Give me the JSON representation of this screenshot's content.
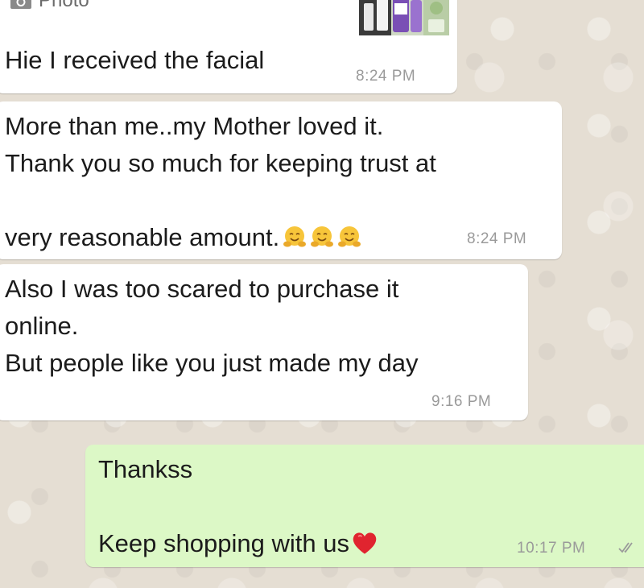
{
  "messages": [
    {
      "photo_label": "Photo",
      "text": "Hie I received the facial",
      "time": "8:24 PM",
      "icon": "camera-icon"
    },
    {
      "text_line1": "More than me..my Mother loved it.",
      "text_line2": "Thank you so much for keeping trust at",
      "text_line3": "very reasonable amount.",
      "emoji": "hugging-face",
      "time": "8:24 PM"
    },
    {
      "text": "Also I was too scared to purchase it\nonline.\nBut people like you just made my day",
      "time": "9:16 PM"
    },
    {
      "text_line1": "Thankss",
      "text_line2": "Keep shopping with us",
      "emoji": "red-heart",
      "time": "10:17 PM",
      "status": "read"
    }
  ],
  "colors": {
    "incoming_bubble": "#ffffff",
    "outgoing_bubble": "#dcf8c6",
    "wallpaper": "#e5ded3",
    "timestamp": "#9a9a9a"
  }
}
